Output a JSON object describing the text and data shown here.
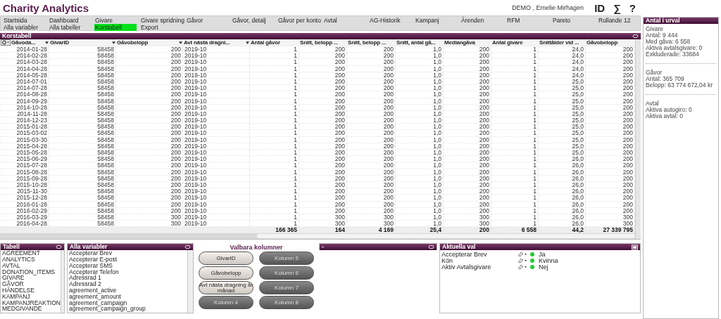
{
  "app_title": "Charity Analytics",
  "user": "DEMO , Emelie Mirhagen",
  "header_buttons": [
    "ID",
    "∑",
    "?"
  ],
  "menu": [
    [
      {
        "label": "Startsida",
        "selected": false
      },
      {
        "label": "Dashboard",
        "selected": false
      },
      {
        "label": "Givare",
        "selected": false
      },
      {
        "label": "Givare spridning",
        "selected": false
      },
      {
        "label": "Gåvor",
        "selected": false
      },
      {
        "label": "Gåvor, detalj",
        "selected": false
      },
      {
        "label": "Gåvor per konto",
        "selected": false
      },
      {
        "label": "Avtal",
        "selected": false
      },
      {
        "label": "AG-Historik",
        "selected": false
      },
      {
        "label": "Kampanj",
        "selected": false
      },
      {
        "label": "Ärenden",
        "selected": false
      },
      {
        "label": "RFM",
        "selected": false
      },
      {
        "label": "Pareto",
        "selected": false
      },
      {
        "label": "Rullande 12",
        "selected": false
      }
    ],
    [
      {
        "label": "Alla variabler",
        "selected": false
      },
      {
        "label": "Alla tabeller",
        "selected": false
      },
      {
        "label": "Korstabell",
        "selected": true
      },
      {
        "label": "Export",
        "selected": false
      }
    ]
  ],
  "table": {
    "title": "Korstabell",
    "columns": [
      {
        "label": "Gåvoda...",
        "dropdown": true
      },
      {
        "label": "GivarID",
        "dropdown": true
      },
      {
        "label": "Gåvobelopp",
        "dropdown": true
      },
      {
        "label": "Avt nästa dragni...",
        "dropdown": true
      },
      {
        "label": "Antal gåvor",
        "dropdown": false
      },
      {
        "label": "Snitt, belopp ...",
        "dropdown": false
      },
      {
        "label": "Snitt, belopp ...",
        "dropdown": false
      },
      {
        "label": "Snitt, antal gå...",
        "dropdown": false
      },
      {
        "label": "Mediangåva",
        "dropdown": false
      },
      {
        "label": "Antal givare",
        "dropdown": false
      },
      {
        "label": "Snittålder vid ...",
        "dropdown": false
      },
      {
        "label": "Gåvobelopp",
        "dropdown": false
      }
    ],
    "rows": [
      [
        "2014-01-28",
        "58458",
        "200",
        "2019-10",
        "1",
        "200",
        "200",
        "1,0",
        "200",
        "1",
        "24,0",
        "200"
      ],
      [
        "2014-02-28",
        "58458",
        "200",
        "2019-10",
        "1",
        "200",
        "200",
        "1,0",
        "200",
        "1",
        "24,0",
        "200"
      ],
      [
        "2014-03-28",
        "58458",
        "200",
        "2019-10",
        "1",
        "200",
        "200",
        "1,0",
        "200",
        "1",
        "24,0",
        "200"
      ],
      [
        "2014-04-28",
        "58458",
        "200",
        "2019-10",
        "1",
        "200",
        "200",
        "1,0",
        "200",
        "1",
        "24,0",
        "200"
      ],
      [
        "2014-05-28",
        "58458",
        "200",
        "2019-10",
        "1",
        "200",
        "200",
        "1,0",
        "200",
        "1",
        "24,0",
        "200"
      ],
      [
        "2014-07-01",
        "58458",
        "200",
        "2019-10",
        "1",
        "200",
        "200",
        "1,0",
        "200",
        "1",
        "25,0",
        "200"
      ],
      [
        "2014-07-28",
        "58458",
        "200",
        "2019-10",
        "1",
        "200",
        "200",
        "1,0",
        "200",
        "1",
        "25,0",
        "200"
      ],
      [
        "2014-08-28",
        "58458",
        "200",
        "2019-10",
        "1",
        "200",
        "200",
        "1,0",
        "200",
        "1",
        "25,0",
        "200"
      ],
      [
        "2014-09-29",
        "58458",
        "200",
        "2019-10",
        "1",
        "200",
        "200",
        "1,0",
        "200",
        "1",
        "25,0",
        "200"
      ],
      [
        "2014-10-28",
        "58458",
        "200",
        "2019-10",
        "1",
        "200",
        "200",
        "1,0",
        "200",
        "1",
        "25,0",
        "200"
      ],
      [
        "2014-11-28",
        "58458",
        "200",
        "2019-10",
        "1",
        "200",
        "200",
        "1,0",
        "200",
        "1",
        "25,0",
        "200"
      ],
      [
        "2014-12-23",
        "58458",
        "200",
        "2019-10",
        "1",
        "200",
        "200",
        "1,0",
        "200",
        "1",
        "25,0",
        "200"
      ],
      [
        "2015-01-28",
        "58458",
        "200",
        "2019-10",
        "1",
        "200",
        "200",
        "1,0",
        "200",
        "1",
        "25,0",
        "200"
      ],
      [
        "2015-03-02",
        "58458",
        "200",
        "2019-10",
        "1",
        "200",
        "200",
        "1,0",
        "200",
        "1",
        "25,0",
        "200"
      ],
      [
        "2015-03-30",
        "58458",
        "200",
        "2019-10",
        "1",
        "200",
        "200",
        "1,0",
        "200",
        "1",
        "25,0",
        "200"
      ],
      [
        "2015-04-28",
        "58458",
        "200",
        "2019-10",
        "1",
        "200",
        "200",
        "1,0",
        "200",
        "1",
        "25,0",
        "200"
      ],
      [
        "2015-05-28",
        "58458",
        "200",
        "2019-10",
        "1",
        "200",
        "200",
        "1,0",
        "200",
        "1",
        "25,0",
        "200"
      ],
      [
        "2015-06-29",
        "58458",
        "200",
        "2019-10",
        "1",
        "200",
        "200",
        "1,0",
        "200",
        "1",
        "26,0",
        "200"
      ],
      [
        "2015-07-28",
        "58458",
        "200",
        "2019-10",
        "1",
        "200",
        "200",
        "1,0",
        "200",
        "1",
        "26,0",
        "200"
      ],
      [
        "2015-08-28",
        "58458",
        "200",
        "2019-10",
        "1",
        "200",
        "200",
        "1,0",
        "200",
        "1",
        "26,0",
        "200"
      ],
      [
        "2015-09-28",
        "58458",
        "200",
        "2019-10",
        "1",
        "200",
        "200",
        "1,0",
        "200",
        "1",
        "26,0",
        "200"
      ],
      [
        "2015-10-28",
        "58458",
        "200",
        "2019-10",
        "1",
        "200",
        "200",
        "1,0",
        "200",
        "1",
        "26,0",
        "200"
      ],
      [
        "2015-11-30",
        "58458",
        "200",
        "2019-10",
        "1",
        "200",
        "200",
        "1,0",
        "200",
        "1",
        "26,0",
        "200"
      ],
      [
        "2015-12-28",
        "58458",
        "200",
        "2019-10",
        "1",
        "200",
        "200",
        "1,0",
        "200",
        "1",
        "26,0",
        "200"
      ],
      [
        "2016-01-28",
        "58458",
        "200",
        "2019-10",
        "1",
        "200",
        "200",
        "1,0",
        "200",
        "1",
        "26,0",
        "200"
      ],
      [
        "2016-02-29",
        "58458",
        "200",
        "2019-10",
        "1",
        "200",
        "200",
        "1,0",
        "200",
        "1",
        "26,0",
        "200"
      ],
      [
        "2016-03-29",
        "58458",
        "300",
        "2019-10",
        "1",
        "300",
        "300",
        "1,0",
        "300",
        "1",
        "26,0",
        "300"
      ],
      [
        "2016-04-28",
        "58458",
        "300",
        "2019-10",
        "1",
        "300",
        "300",
        "1,0",
        "300",
        "1",
        "26,0",
        "300"
      ]
    ],
    "totals": [
      "166 365",
      "164",
      "4 169",
      "25,4",
      "200",
      "6 558",
      "44,2",
      "27 339 795"
    ]
  },
  "tabell": {
    "title": "Tabell",
    "items": [
      "AGREEMENT",
      "ANALYTICS",
      "AVTAL",
      "DONATION_ITEMS",
      "GIVARE",
      "GÅVOR",
      "HÄNDELSE",
      "KAMPANJ",
      "KAMPANJREAKTION",
      "MEDGIVANDE"
    ]
  },
  "alla_variabler": {
    "title": "Alla variabler",
    "items": [
      "Accepterar Brev",
      "Accepterar E-post",
      "Accepterar SMS",
      "Accepterar Telefon",
      "Adressrad 1",
      "Adressrad 2",
      "agreement_active",
      "agreement_amount",
      "agreement_campaign",
      "agreement_campaign_group"
    ]
  },
  "valbara": {
    "title": "Valbara kolumner",
    "buttons": [
      {
        "label": "GivarID",
        "active": true
      },
      {
        "label": "Gåvobelopp",
        "active": true
      },
      {
        "label": "Avt nästa dragning år månad",
        "active": true
      },
      {
        "label": "Kolumn 4",
        "active": false
      },
      {
        "label": "Kolumn 5",
        "active": false
      },
      {
        "label": "Kolumn 6",
        "active": false
      },
      {
        "label": "Kolumn 7",
        "active": false
      },
      {
        "label": "Kolumn 8",
        "active": false
      }
    ]
  },
  "empty_panel": {
    "title": "-"
  },
  "aktuella_val": {
    "title": "Aktuella val",
    "rows": [
      {
        "field": "Accepterar Brev",
        "value": "Ja"
      },
      {
        "field": "Kön",
        "value": "Kvinna"
      },
      {
        "field": "Aktiv Avtalsgivare",
        "value": "Nej"
      }
    ]
  },
  "urval": {
    "title": "Antal i urval",
    "sections": [
      [
        "Givare",
        "Antal: 9 444",
        "Med gåva: 6 558",
        "Aktiva avtalsgivare: 0",
        "Exkluderade: 33684"
      ],
      [
        "Gåvor",
        "Antal: 365 709",
        "Belopp: 63 774 672,04 kr"
      ],
      [
        "Avtal",
        "Aktiva autogiro: 0",
        "Aktiva avtal: 0"
      ]
    ]
  }
}
